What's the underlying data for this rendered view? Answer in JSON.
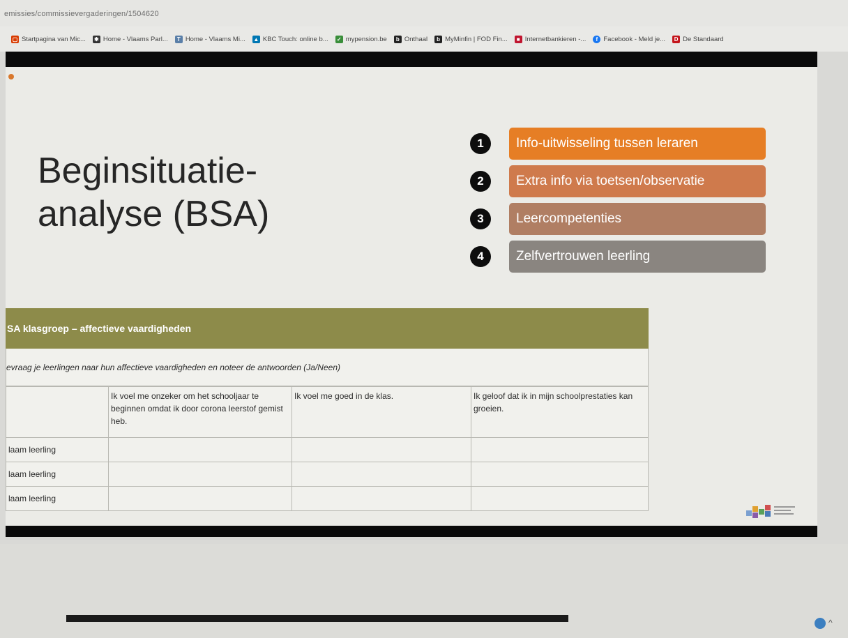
{
  "browser": {
    "url": "emissies/commissievergaderingen/1504620",
    "bookmarks": [
      {
        "label": "Startpagina van Mic...",
        "icon": "office-icon",
        "color": "#d83b01"
      },
      {
        "label": "Home - Vlaams Parl...",
        "icon": "parliament-icon",
        "color": "#333333"
      },
      {
        "label": "Home - Vlaams Mi...",
        "icon": "ministry-icon",
        "color": "#5a7fa8"
      },
      {
        "label": "KBC Touch: online b...",
        "icon": "kbc-icon",
        "color": "#0077b3"
      },
      {
        "label": "mypension.be",
        "icon": "pension-icon",
        "color": "#3a8e3a"
      },
      {
        "label": "Onthaal",
        "icon": "be-icon",
        "color": "#222222"
      },
      {
        "label": "MyMinfin | FOD Fin...",
        "icon": "be-icon",
        "color": "#222222"
      },
      {
        "label": "Internetbankieren -...",
        "icon": "bank-icon",
        "color": "#c0152f"
      },
      {
        "label": "Facebook - Meld je...",
        "icon": "facebook-icon",
        "color": "#1877f2"
      },
      {
        "label": "De Standaard",
        "icon": "ds-icon",
        "color": "#c4161c"
      }
    ]
  },
  "slide": {
    "title_line1": "Beginsituatie-",
    "title_line2": "analyse (BSA)",
    "steps": [
      {
        "number": "1",
        "label": "Info-uitwisseling tussen leraren",
        "color": "#e67e25"
      },
      {
        "number": "2",
        "label": "Extra info via toetsen/observatie",
        "color": "#cf7a4c"
      },
      {
        "number": "3",
        "label": "Leercompetenties",
        "color": "#b07e63"
      },
      {
        "number": "4",
        "label": "Zelfvertrouwen leerling",
        "color": "#8a8580"
      }
    ],
    "table": {
      "header": "SA klasgroep – affectieve vaardigheden",
      "header_color": "#8d8b4a",
      "instruction": "evraag je leerlingen naar hun affectieve vaardigheden en noteer de antwoorden (Ja/Neen)",
      "columns": [
        "Ik voel me onzeker om het schooljaar te beginnen omdat ik door corona leerstof gemist heb.",
        "Ik voel me goed in de klas.",
        "Ik geloof dat ik in mijn schoolprestaties kan groeien."
      ],
      "rows": [
        "laam leerling",
        "laam leerling",
        "laam leerling"
      ]
    }
  }
}
